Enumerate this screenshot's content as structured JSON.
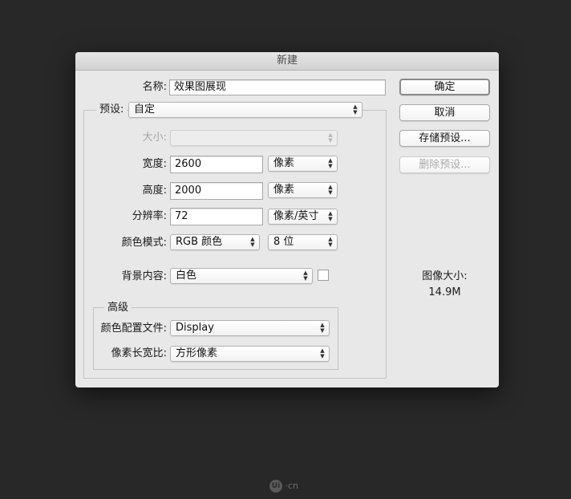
{
  "dialog": {
    "title": "新建",
    "name_label": "名称:",
    "name_value": "效果图展现",
    "preset_label": "预设:",
    "preset_value": "自定",
    "size_label": "大小:",
    "size_value": "",
    "width_label": "宽度:",
    "width_value": "2600",
    "width_unit": "像素",
    "height_label": "高度:",
    "height_value": "2000",
    "height_unit": "像素",
    "resolution_label": "分辨率:",
    "resolution_value": "72",
    "resolution_unit": "像素/英寸",
    "color_mode_label": "颜色模式:",
    "color_mode_value": "RGB 颜色",
    "bit_depth_value": "8 位",
    "background_label": "背景内容:",
    "background_value": "白色",
    "background_swatch_color": "#ffffff",
    "advanced_label": "高级",
    "color_profile_label": "颜色配置文件:",
    "color_profile_value": "Display",
    "pixel_aspect_label": "像素长宽比:",
    "pixel_aspect_value": "方形像素"
  },
  "buttons": {
    "ok": "确定",
    "cancel": "取消",
    "save_preset": "存储预设...",
    "delete_preset": "删除预设..."
  },
  "image_size": {
    "label": "图像大小:",
    "value": "14.9M"
  },
  "watermark": {
    "logo_text": "Ui",
    "suffix": "·cn"
  }
}
